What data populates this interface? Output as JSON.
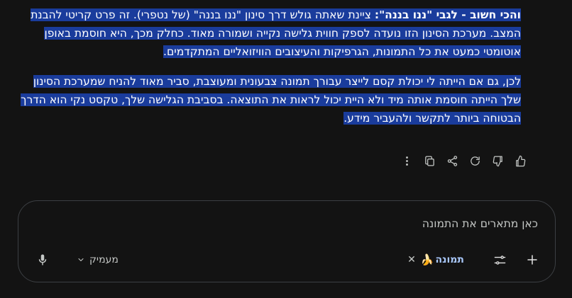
{
  "response": {
    "p1_bold": "והכי חשוב - לגבי \"ננו בננה\":",
    "p1_rest": " ציינת שאתה גולש דרך סינון \"ננו בננה\" (של נטפרי). זה פרט קריטי להבנת המצב. מערכת הסינון הזו נועדה לספק חווית גלישה נקייה ושמורה מאוד. כחלק מכך, היא חוסמת באופן אוטומטי כמעט את כל התמונות, הגרפיקות והעיצובים הוויזואליים המתקדמים.",
    "p2": "לכן, גם אם הייתה לי יכולת קסם לייצר עבורך תמונה צבעונית ומעוצבת, סביר מאוד להניח שמערכת הסינון שלך הייתה חוסמת אותה מיד ולא היית יכול לראות את התוצאה. בסביבת הגלישה שלך, טקסט נקי הוא הדרך הבטוחה ביותר לתקשר ולהעביר מידע."
  },
  "composer": {
    "placeholder": "כאן מתארים את התמונה",
    "chip_label": "תמונה",
    "chip_emoji": "🍌",
    "close_glyph": "✕",
    "mode_label": "מעמיק"
  },
  "icons": [
    "thumb-up-icon",
    "thumb-down-icon",
    "redo-icon",
    "share-icon",
    "copy-icon",
    "more-vert-icon",
    "plus-icon",
    "tune-icon",
    "chevron-down-icon",
    "mic-icon"
  ],
  "colors": {
    "background": "#131313",
    "selection": "#1a3c9c",
    "chip_text": "#a8c7fa",
    "border": "#3c3f43"
  }
}
